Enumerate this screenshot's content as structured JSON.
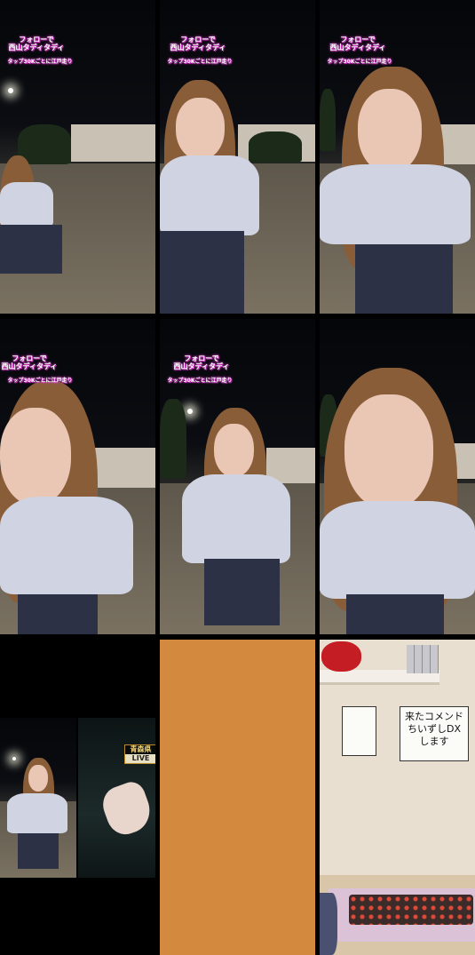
{
  "overlay": {
    "follow_line1": "フォローで",
    "follow_line2": "西山タディタディ",
    "tap_line": "タップ30Kごとに江戸走り"
  },
  "inset": {
    "badge_line1": "青森県",
    "badge_line2": "LIVE"
  },
  "room": {
    "board_line1": "来たコメンド",
    "board_line2": "ちいずしDX",
    "board_line3": "します"
  },
  "colors": {
    "orange_panel": "#d48a3e",
    "overlay_glow": "#e03fd0"
  }
}
